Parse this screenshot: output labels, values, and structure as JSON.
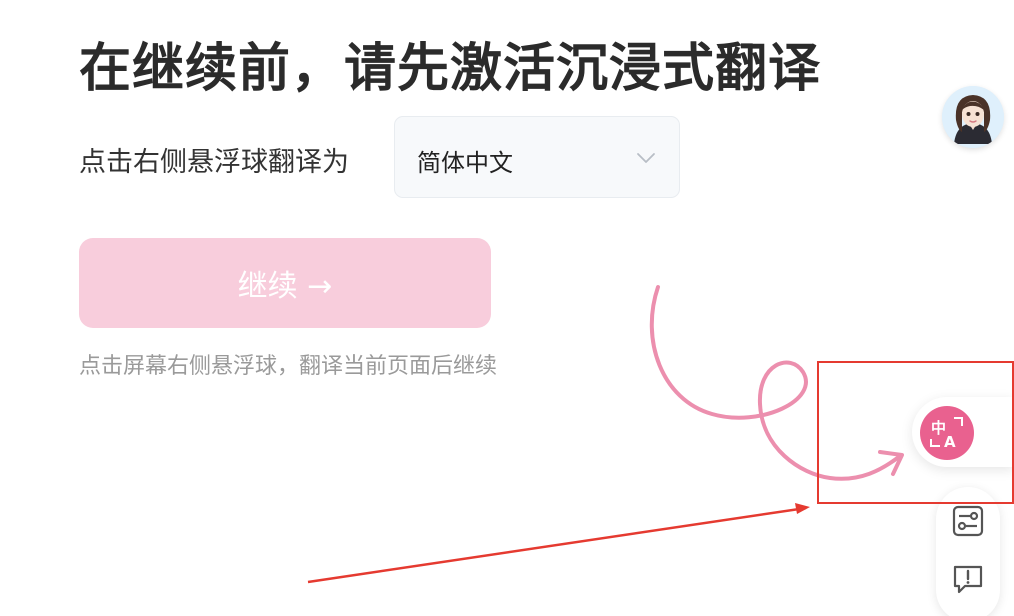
{
  "page": {
    "title": "在继续前，请先激活沉浸式翻译",
    "instruction_label": "点击右侧悬浮球翻译为",
    "hint": "点击屏幕右侧悬浮球，翻译当前页面后继续"
  },
  "language_select": {
    "value": "简体中文",
    "icon": "chevron-down-icon"
  },
  "continue_button": {
    "label": "继续 →",
    "bg_color": "#f8cddc"
  },
  "float_ball": {
    "icon": "translate-icon",
    "color": "#e9618f"
  },
  "side_panel": {
    "items": [
      {
        "icon": "settings-sliders-icon"
      },
      {
        "icon": "feedback-icon"
      }
    ]
  },
  "annotations": {
    "highlight_color": "#e53a30",
    "arrow_color": "#e53a30"
  }
}
